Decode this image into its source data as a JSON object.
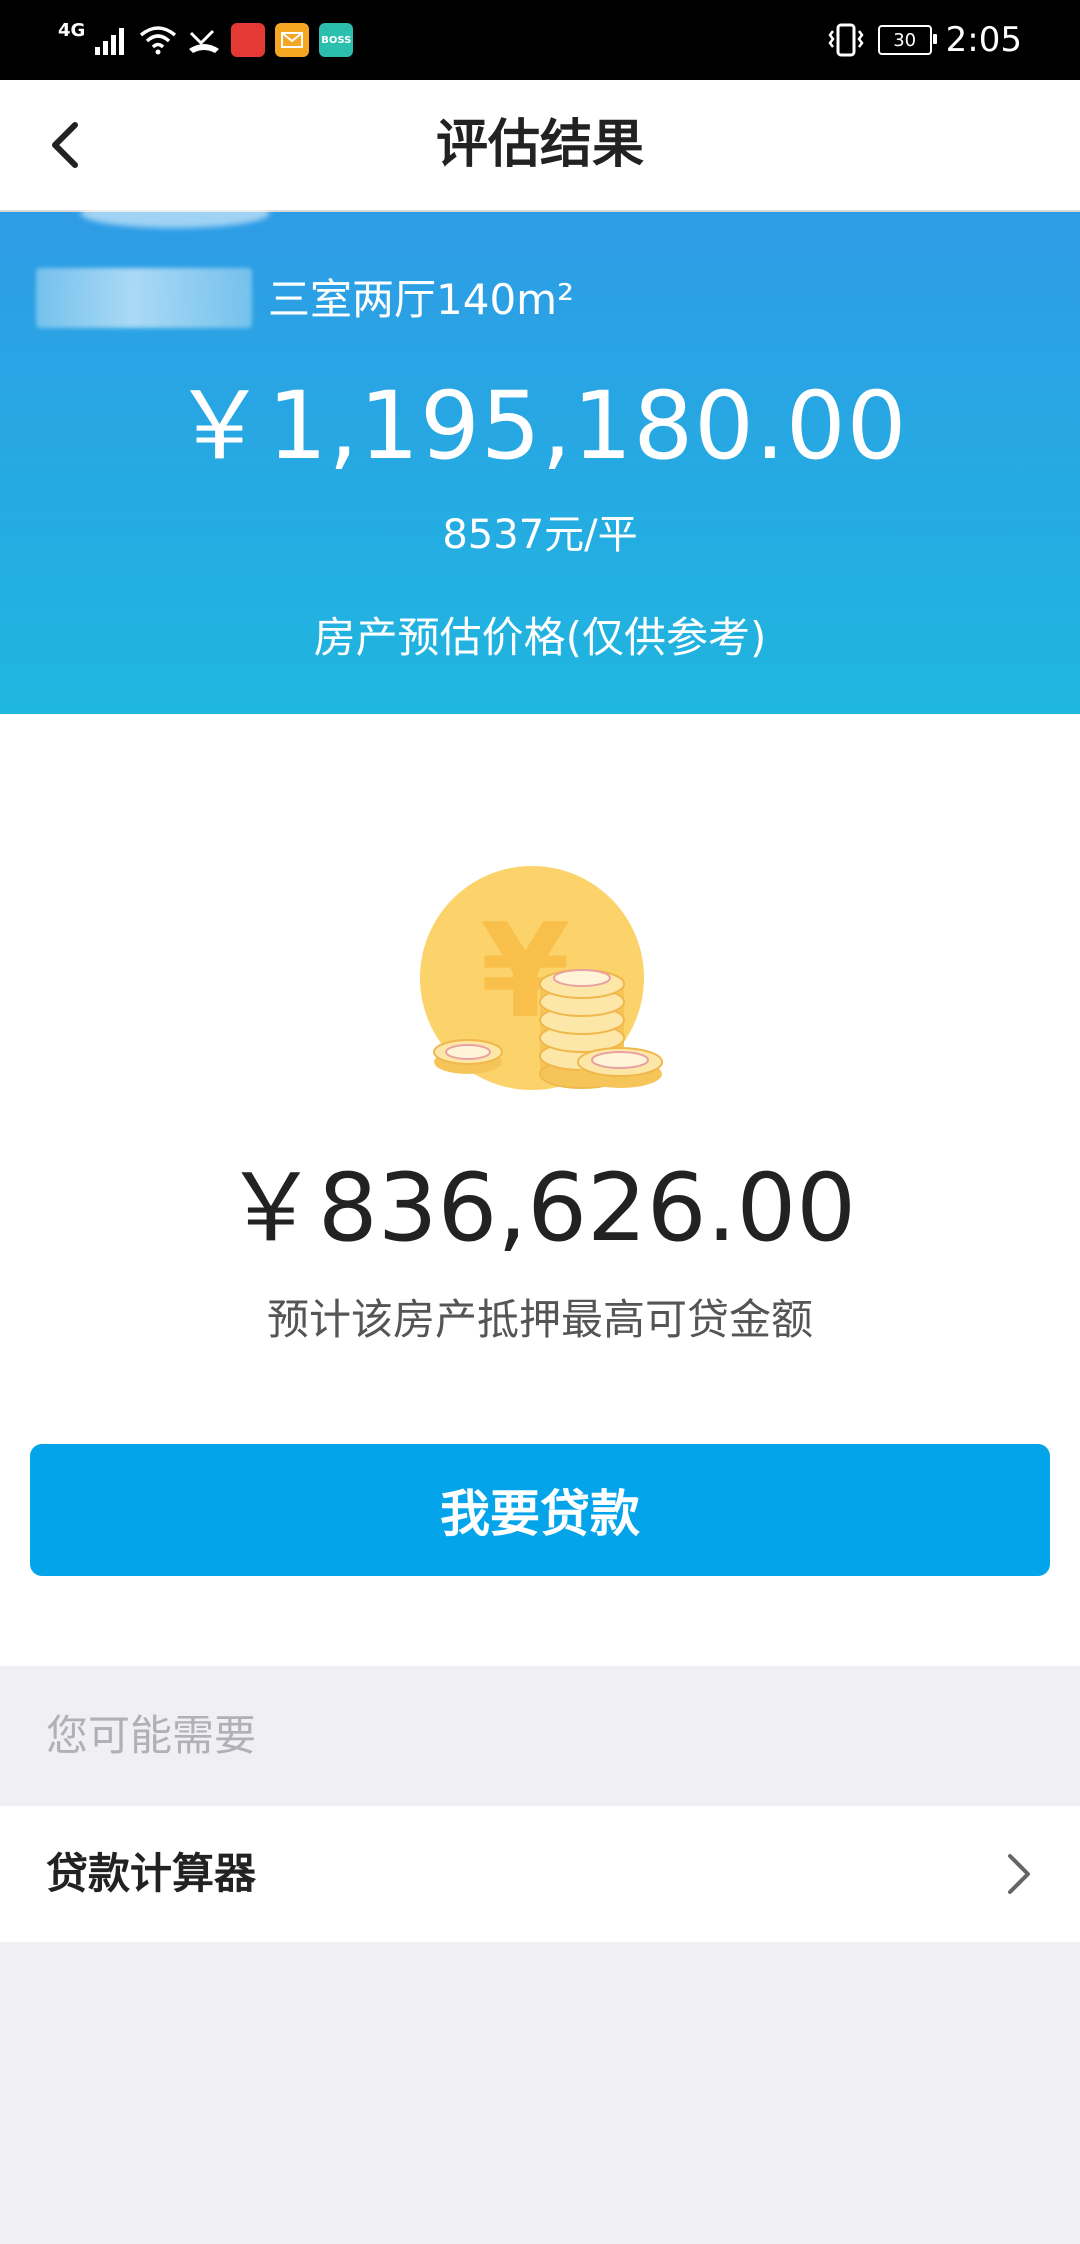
{
  "status_bar": {
    "network": "4G",
    "time": "2:05",
    "battery": "30",
    "apps": [
      {
        "icon": "app-red-icon",
        "color": "#e53935",
        "label": ""
      },
      {
        "icon": "mail-app-icon",
        "color": "#f5a623",
        "label": ""
      },
      {
        "icon": "boss-app-icon",
        "color": "#2bbfae",
        "label": "BOSS"
      }
    ]
  },
  "nav": {
    "title": "评估结果"
  },
  "estimate": {
    "house_desc": "三室两厅140m²",
    "price": "￥1,195,180.00",
    "unit_price": "8537元/平",
    "note": "房产预估价格(仅供参考)"
  },
  "loan": {
    "amount": "￥836,626.00",
    "note": "预计该房产抵押最高可贷金额",
    "button_label": "我要贷款"
  },
  "suggest": {
    "section_label": "您可能需要",
    "items": [
      {
        "label": "贷款计算器"
      }
    ]
  },
  "colors": {
    "header_gradient_top": "#2e9ce6",
    "header_gradient_bottom": "#1fb6df",
    "primary_button": "#03a4ea",
    "coin_gold": "#fcd26b",
    "page_background": "#efeff4"
  }
}
